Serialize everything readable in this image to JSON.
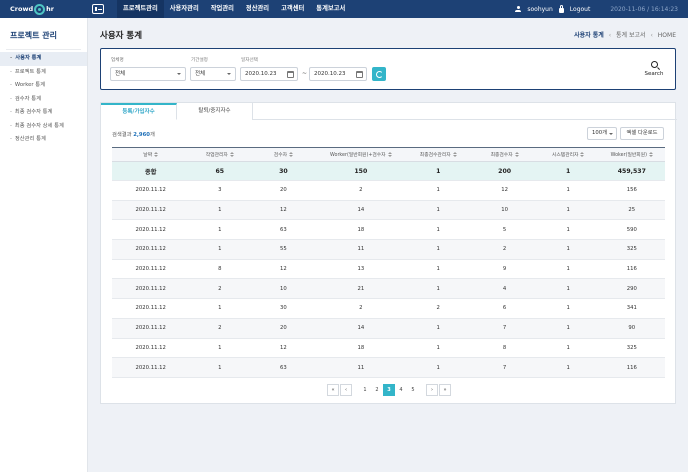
{
  "app": {
    "logo_left": "Crowd",
    "logo_right": "hr"
  },
  "nav": [
    "프로젝트관리",
    "사용자관리",
    "작업관리",
    "정산관리",
    "고객센터",
    "통계보고서"
  ],
  "user": {
    "name": "soohyun",
    "logout": "Logout",
    "datetime": "2020-11-06 / 16:14:23"
  },
  "sidebar": {
    "title": "프로젝트 관리",
    "items": [
      "사용자 통계",
      "프로젝트 통계",
      "Worker 통계",
      "검수자 통계",
      "최종 검수자 통계",
      "최종 검수자 상세 통계",
      "정산관리 통계"
    ]
  },
  "page": {
    "title": "사용자 통계"
  },
  "breadcrumb": [
    "사용자 통계",
    "통계 보고서",
    "HOME"
  ],
  "search": {
    "label_type": "업체명",
    "label_period": "기간설정",
    "label_date": "일자선택",
    "type_value": "전체",
    "period_value": "전체",
    "date_from": "2020.10.23",
    "date_to": "2020.10.23",
    "tilde": "~",
    "button": "Search"
  },
  "tabs": [
    "등록/가입자수",
    "탈퇴/중지자수"
  ],
  "results": {
    "prefix": "검색결과",
    "count": "2,960",
    "suffix": "개",
    "page_size": "100개",
    "excel": "엑셀 다운로드"
  },
  "table": {
    "columns": [
      "날짜",
      "작업관리자",
      "검수자",
      "Worker(일반회원)+검수자",
      "최종검수관리자",
      "최종검수자",
      "시스템관리자",
      "Woker(일반회원)"
    ],
    "total": [
      "종합",
      "65",
      "30",
      "150",
      "1",
      "200",
      "1",
      "459,537"
    ],
    "rows": [
      [
        "2020.11.12",
        "3",
        "20",
        "2",
        "1",
        "12",
        "1",
        "156"
      ],
      [
        "2020.11.12",
        "1",
        "12",
        "14",
        "1",
        "10",
        "1",
        "25"
      ],
      [
        "2020.11.12",
        "1",
        "63",
        "18",
        "1",
        "5",
        "1",
        "590"
      ],
      [
        "2020.11.12",
        "1",
        "55",
        "11",
        "1",
        "2",
        "1",
        "325"
      ],
      [
        "2020.11.12",
        "8",
        "12",
        "13",
        "1",
        "9",
        "1",
        "116"
      ],
      [
        "2020.11.12",
        "2",
        "10",
        "21",
        "1",
        "4",
        "1",
        "290"
      ],
      [
        "2020.11.12",
        "1",
        "30",
        "2",
        "2",
        "6",
        "1",
        "341"
      ],
      [
        "2020.11.12",
        "2",
        "20",
        "14",
        "1",
        "7",
        "1",
        "90"
      ],
      [
        "2020.11.12",
        "1",
        "12",
        "18",
        "1",
        "8",
        "1",
        "325"
      ],
      [
        "2020.11.12",
        "1",
        "63",
        "11",
        "1",
        "7",
        "1",
        "116"
      ]
    ]
  },
  "pagination": {
    "first": "«",
    "prev": "‹",
    "pages": [
      "1",
      "2",
      "3",
      "4",
      "5"
    ],
    "current": "3",
    "next": "›",
    "last": "»"
  },
  "colors": {
    "navy": "#1d4175",
    "accent": "#33b5c9",
    "total_row": "#e4f4f3"
  }
}
